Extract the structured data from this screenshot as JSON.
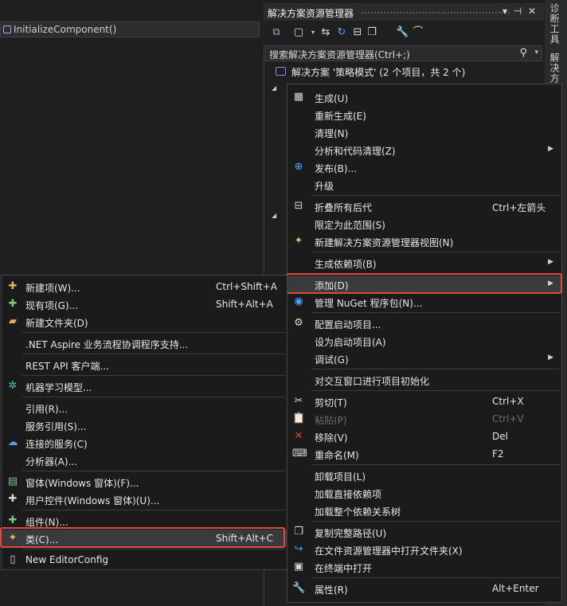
{
  "editor": {
    "member_dropdown": "InitializeComponent()"
  },
  "solution_explorer": {
    "title": "解决方案资源管理器",
    "search_placeholder": "搜索解决方案资源管理器(Ctrl+;)",
    "solution_label": "解决方案 '策略模式' (2 个项目，共 2 个)",
    "title_buttons": [
      "▾",
      "⊣",
      "✕"
    ]
  },
  "vertical_tabs": [
    "诊断工具",
    "解决方案"
  ],
  "main_menu": {
    "items": [
      {
        "icon": "build-icon",
        "label": "生成(U)",
        "shortcut": "",
        "submenu": false
      },
      {
        "icon": "",
        "label": "重新生成(E)",
        "shortcut": "",
        "submenu": false
      },
      {
        "icon": "",
        "label": "清理(N)",
        "shortcut": "",
        "submenu": false
      },
      {
        "icon": "",
        "label": "分析和代码清理(Z)",
        "shortcut": "",
        "submenu": true
      },
      {
        "icon": "globe-icon",
        "label": "发布(B)...",
        "shortcut": "",
        "submenu": false
      },
      {
        "icon": "",
        "label": "升级",
        "shortcut": "",
        "submenu": false
      },
      {
        "icon": "collapse-icon",
        "label": "折叠所有后代",
        "shortcut": "Ctrl+左箭头",
        "submenu": false
      },
      {
        "icon": "",
        "label": "限定为此范围(S)",
        "shortcut": "",
        "submenu": false
      },
      {
        "icon": "new-view-icon",
        "label": "新建解决方案资源管理器视图(N)",
        "shortcut": "",
        "submenu": false
      },
      {
        "icon": "",
        "label": "生成依赖项(B)",
        "shortcut": "",
        "submenu": true
      },
      {
        "icon": "",
        "label": "添加(D)",
        "shortcut": "",
        "submenu": true
      },
      {
        "icon": "nuget-icon",
        "label": "管理 NuGet 程序包(N)...",
        "shortcut": "",
        "submenu": false
      },
      {
        "icon": "gear-icon",
        "label": "配置启动项目...",
        "shortcut": "",
        "submenu": false
      },
      {
        "icon": "",
        "label": "设为启动项目(A)",
        "shortcut": "",
        "submenu": false
      },
      {
        "icon": "",
        "label": "调试(G)",
        "shortcut": "",
        "submenu": true
      },
      {
        "icon": "",
        "label": "对交互窗口进行项目初始化",
        "shortcut": "",
        "submenu": false
      },
      {
        "icon": "scissors-icon",
        "label": "剪切(T)",
        "shortcut": "Ctrl+X",
        "submenu": false
      },
      {
        "icon": "paste-icon",
        "label": "粘贴(P)",
        "shortcut": "Ctrl+V",
        "submenu": false
      },
      {
        "icon": "delete-icon",
        "label": "移除(V)",
        "shortcut": "Del",
        "submenu": false
      },
      {
        "icon": "rename-icon",
        "label": "重命名(M)",
        "shortcut": "F2",
        "submenu": false
      },
      {
        "icon": "",
        "label": "卸载项目(L)",
        "shortcut": "",
        "submenu": false
      },
      {
        "icon": "",
        "label": "加载直接依赖项",
        "shortcut": "",
        "submenu": false
      },
      {
        "icon": "",
        "label": "加载整个依赖关系树",
        "shortcut": "",
        "submenu": false
      },
      {
        "icon": "copy-icon",
        "label": "复制完整路径(U)",
        "shortcut": "",
        "submenu": false
      },
      {
        "icon": "open-folder-icon",
        "label": "在文件资源管理器中打开文件夹(X)",
        "shortcut": "",
        "submenu": false
      },
      {
        "icon": "terminal-icon",
        "label": "在终端中打开",
        "shortcut": "",
        "submenu": false
      },
      {
        "icon": "wrench-icon",
        "label": "属性(R)",
        "shortcut": "Alt+Enter",
        "submenu": false
      }
    ]
  },
  "add_menu": {
    "items": [
      {
        "icon": "new-item-icon",
        "label": "新建项(W)...",
        "shortcut": "Ctrl+Shift+A"
      },
      {
        "icon": "existing-item-icon",
        "label": "现有项(G)...",
        "shortcut": "Shift+Alt+A"
      },
      {
        "icon": "new-folder-icon",
        "label": "新建文件夹(D)",
        "shortcut": ""
      },
      {
        "icon": "",
        "label": ".NET Aspire 业务流程协调程序支持...",
        "shortcut": ""
      },
      {
        "icon": "",
        "label": "REST API 客户端...",
        "shortcut": ""
      },
      {
        "icon": "ml-model-icon",
        "label": "机器学习模型...",
        "shortcut": ""
      },
      {
        "icon": "",
        "label": "引用(R)...",
        "shortcut": ""
      },
      {
        "icon": "",
        "label": "服务引用(S)...",
        "shortcut": ""
      },
      {
        "icon": "connected-service-icon",
        "label": "连接的服务(C)",
        "shortcut": ""
      },
      {
        "icon": "",
        "label": "分析器(A)...",
        "shortcut": ""
      },
      {
        "icon": "windows-form-icon",
        "label": "窗体(Windows 窗体)(F)...",
        "shortcut": ""
      },
      {
        "icon": "user-control-icon",
        "label": "用户控件(Windows 窗体)(U)...",
        "shortcut": ""
      },
      {
        "icon": "component-icon",
        "label": "组件(N)...",
        "shortcut": ""
      },
      {
        "icon": "class-icon",
        "label": "类(C)...",
        "shortcut": "Shift+Alt+C"
      },
      {
        "icon": "file-icon",
        "label": "New EditorConfig",
        "shortcut": ""
      }
    ]
  },
  "colors": {
    "highlight_border": "#e0493e",
    "menu_bg": "#1b1b1c",
    "hover_bg": "#3a3a3d"
  }
}
